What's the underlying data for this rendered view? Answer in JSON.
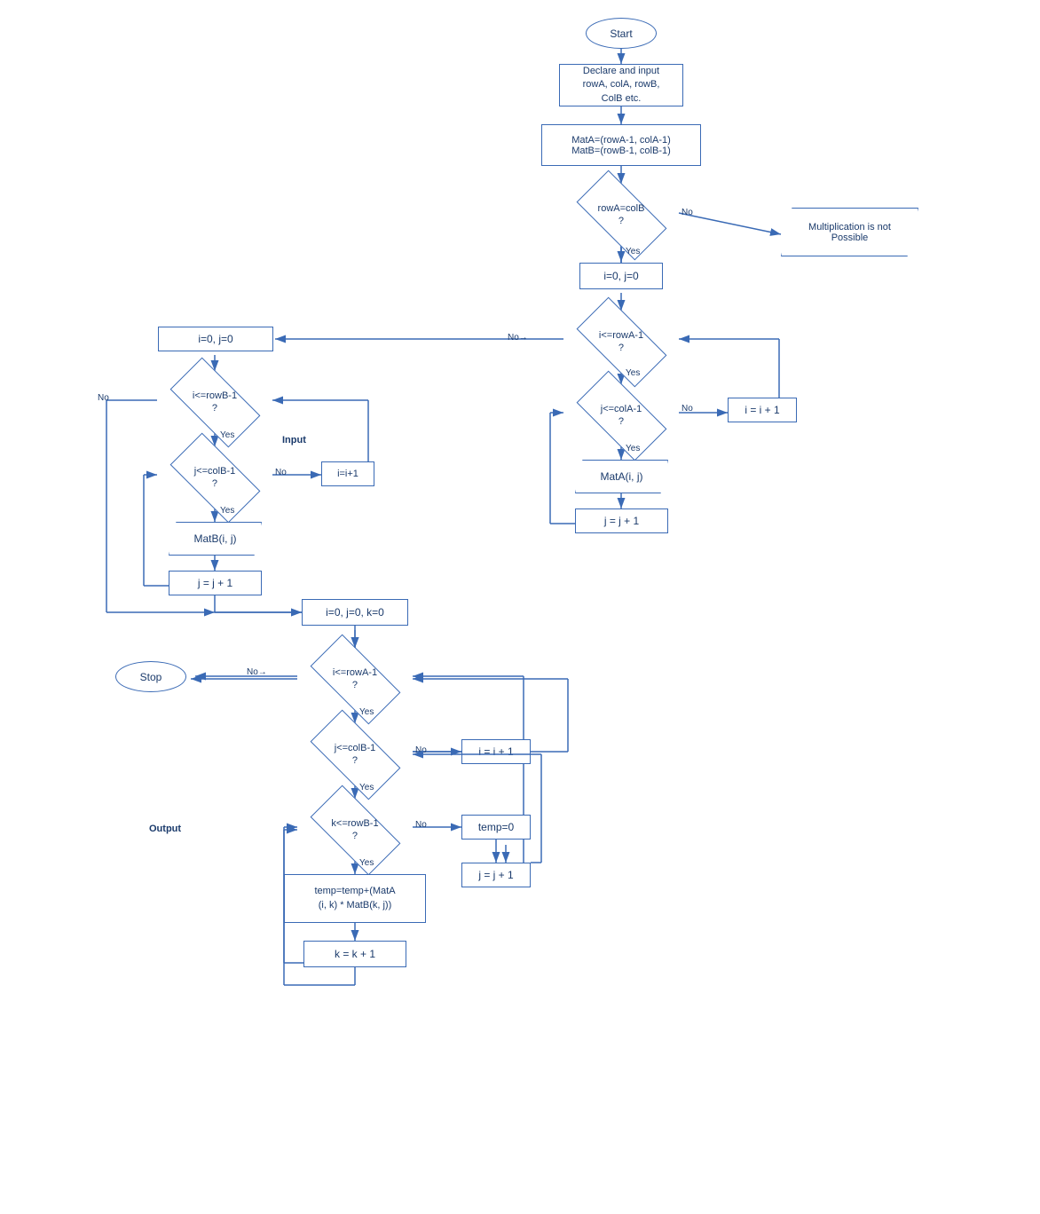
{
  "shapes": {
    "start": {
      "label": "Start"
    },
    "declare": {
      "label": "Declare and input\nrowA, colA, rowB,\nColB etc."
    },
    "matInit": {
      "label": "MatA=(rowA-1, colA-1)\nMatB=(rowB-1, colB-1)"
    },
    "condRowColB": {
      "label": "rowA=colB\n?"
    },
    "notPossible": {
      "label": "Multiplication is not\nPossible"
    },
    "ij00_outer": {
      "label": "i=0, j=0"
    },
    "condIrowA1": {
      "label": "i<=rowA-1\n?"
    },
    "condIcolA1": {
      "label": "j<=colA-1\n?"
    },
    "iPlus1_right": {
      "label": "i = i + 1"
    },
    "matA": {
      "label": "MatA(i, j)"
    },
    "jPlus1_matA": {
      "label": "j = j + 1"
    },
    "ij00_left": {
      "label": "i=0, j=0"
    },
    "condIrowB1": {
      "label": "i<=rowB-1\n?"
    },
    "condJcolB1": {
      "label": "j<=colB-1\n?"
    },
    "iPlus1_input": {
      "label": "i=i+1"
    },
    "matB": {
      "label": "MatB(i, j)"
    },
    "jPlus1_matB": {
      "label": "j = j + 1"
    },
    "ijk000": {
      "label": "i=0, j=0, k=0"
    },
    "condIrowA2": {
      "label": "i<=rowA-1\n?"
    },
    "stop": {
      "label": "Stop"
    },
    "condJcolB2": {
      "label": "j<=colB-1\n?"
    },
    "iPlus1_calc": {
      "label": "i = i + 1"
    },
    "condKrowB2": {
      "label": "k<=rowB-1\n?"
    },
    "temp0": {
      "label": "temp=0"
    },
    "jPlus1_calc": {
      "label": "j = j + 1"
    },
    "tempCalc": {
      "label": "temp=temp+(MatA\n(i, k) * MatB(k, j))"
    },
    "kPlus1": {
      "label": "k = k + 1"
    }
  },
  "labels": {
    "input": "Input",
    "output": "Output",
    "yes": "Yes",
    "no": "No"
  },
  "colors": {
    "stroke": "#3a6ab5",
    "text": "#1a3a6b"
  }
}
